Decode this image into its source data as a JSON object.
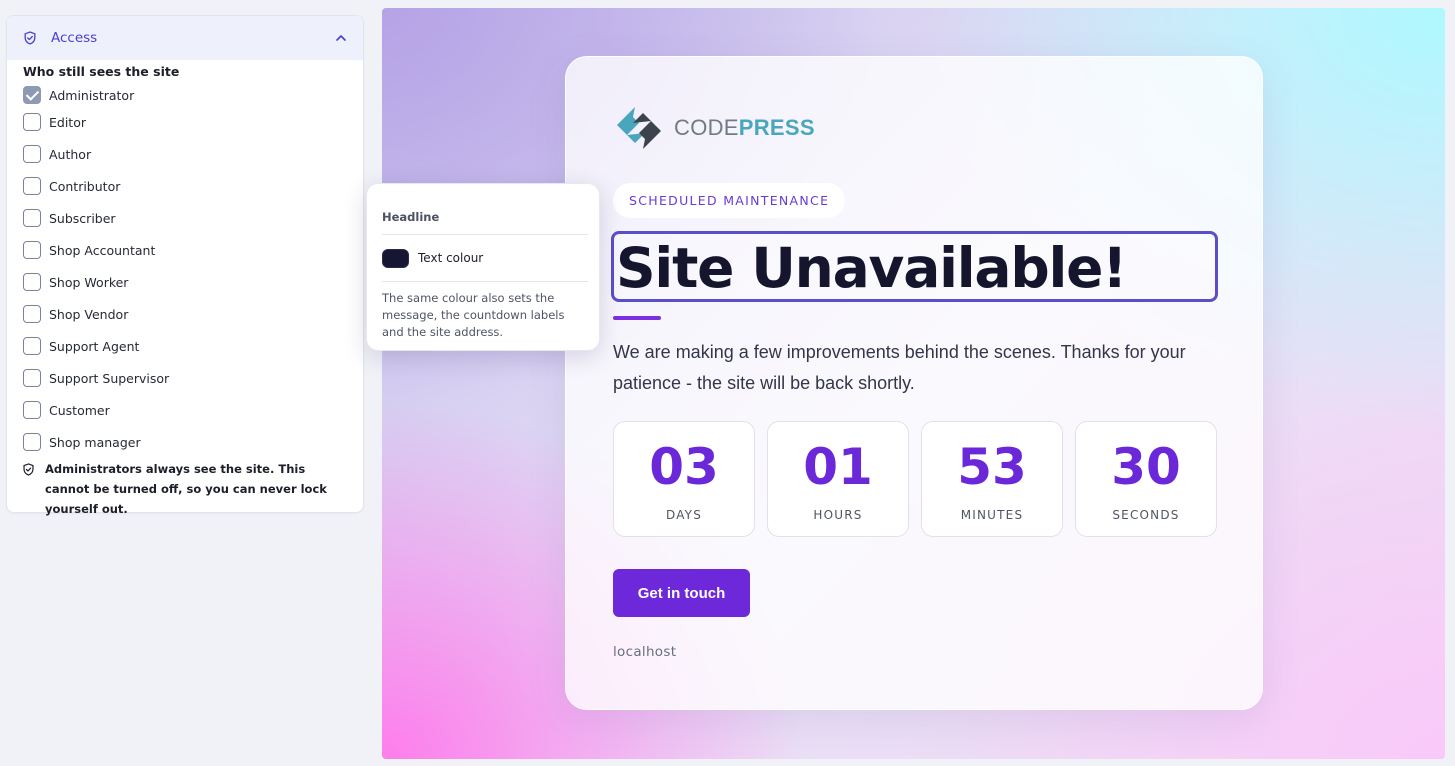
{
  "panel": {
    "title": "Access",
    "group_label": "Who still sees the site",
    "roles": [
      {
        "label": "Administrator",
        "checked": true
      },
      {
        "label": "Editor",
        "checked": false
      },
      {
        "label": "Author",
        "checked": false
      },
      {
        "label": "Contributor",
        "checked": false
      },
      {
        "label": "Subscriber",
        "checked": false
      },
      {
        "label": "Shop Accountant",
        "checked": false
      },
      {
        "label": "Shop Worker",
        "checked": false
      },
      {
        "label": "Shop Vendor",
        "checked": false
      },
      {
        "label": "Support Agent",
        "checked": false
      },
      {
        "label": "Support Supervisor",
        "checked": false
      },
      {
        "label": "Customer",
        "checked": false
      },
      {
        "label": "Shop manager",
        "checked": false
      }
    ],
    "note": "Administrators always see the site. This cannot be turned off, so you can never lock yourself out."
  },
  "popover": {
    "title": "Headline",
    "color_label": "Text colour",
    "color_value": "#161632",
    "help": "The same colour also sets the message, the countdown labels and the site address."
  },
  "preview": {
    "logo": {
      "code": "CODE",
      "press": "PRESS"
    },
    "badge": "SCHEDULED MAINTENANCE",
    "headline": "Site Unavailable!",
    "message": "We are making a few improvements behind the scenes. Thanks for your patience - the site will be back shortly.",
    "countdown": [
      {
        "value": "03",
        "label": "DAYS"
      },
      {
        "value": "01",
        "label": "HOURS"
      },
      {
        "value": "53",
        "label": "MINUTES"
      },
      {
        "value": "30",
        "label": "SECONDS"
      }
    ],
    "cta": "Get in touch",
    "site_address": "localhost"
  },
  "colors": {
    "accent": "#6d28d9",
    "headline_text": "#15152e",
    "panel_accent": "#4a3fd0"
  }
}
